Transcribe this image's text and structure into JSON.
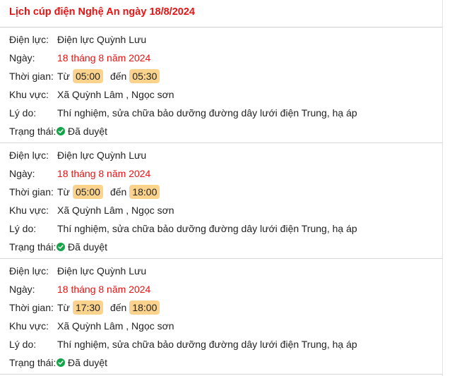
{
  "page": {
    "title": "Lịch cúp điện Nghệ An ngày 18/8/2024"
  },
  "labels": {
    "provider": "Điện lực:",
    "date": "Ngày:",
    "time": "Thời gian:",
    "from": "Từ",
    "to": "đến",
    "area": "Khu vực:",
    "reason": "Lý do:",
    "status": "Trạng thái:"
  },
  "colors": {
    "accent_red": "#e01616",
    "time_pill": "#fbd38d",
    "status_green": "#16a34a"
  },
  "entries": [
    {
      "provider": "Điện lực Quỳnh Lưu",
      "date": "18 tháng 8 năm 2024",
      "start": "05:00",
      "end": "05:30",
      "area": "Xã Quỳnh Lâm , Ngọc sơn",
      "reason": "Thí nghiệm, sửa chữa bảo dưỡng đường dây lưới điện Trung, hạ áp",
      "status": "Đã duyệt",
      "status_icon": "check-circle-icon"
    },
    {
      "provider": "Điện lực Quỳnh Lưu",
      "date": "18 tháng 8 năm 2024",
      "start": "05:00",
      "end": "18:00",
      "area": "Xã Quỳnh Lâm , Ngọc sơn",
      "reason": "Thí nghiệm, sửa chữa bảo dưỡng đường dây lưới điện Trung, hạ áp",
      "status": "Đã duyệt",
      "status_icon": "check-circle-icon"
    },
    {
      "provider": "Điện lực Quỳnh Lưu",
      "date": "18 tháng 8 năm 2024",
      "start": "17:30",
      "end": "18:00",
      "area": "Xã Quỳnh Lâm , Ngọc sơn",
      "reason": "Thí nghiệm, sửa chữa bảo dưỡng đường dây lưới điện Trung, hạ áp",
      "status": "Đã duyệt",
      "status_icon": "check-circle-icon"
    }
  ]
}
